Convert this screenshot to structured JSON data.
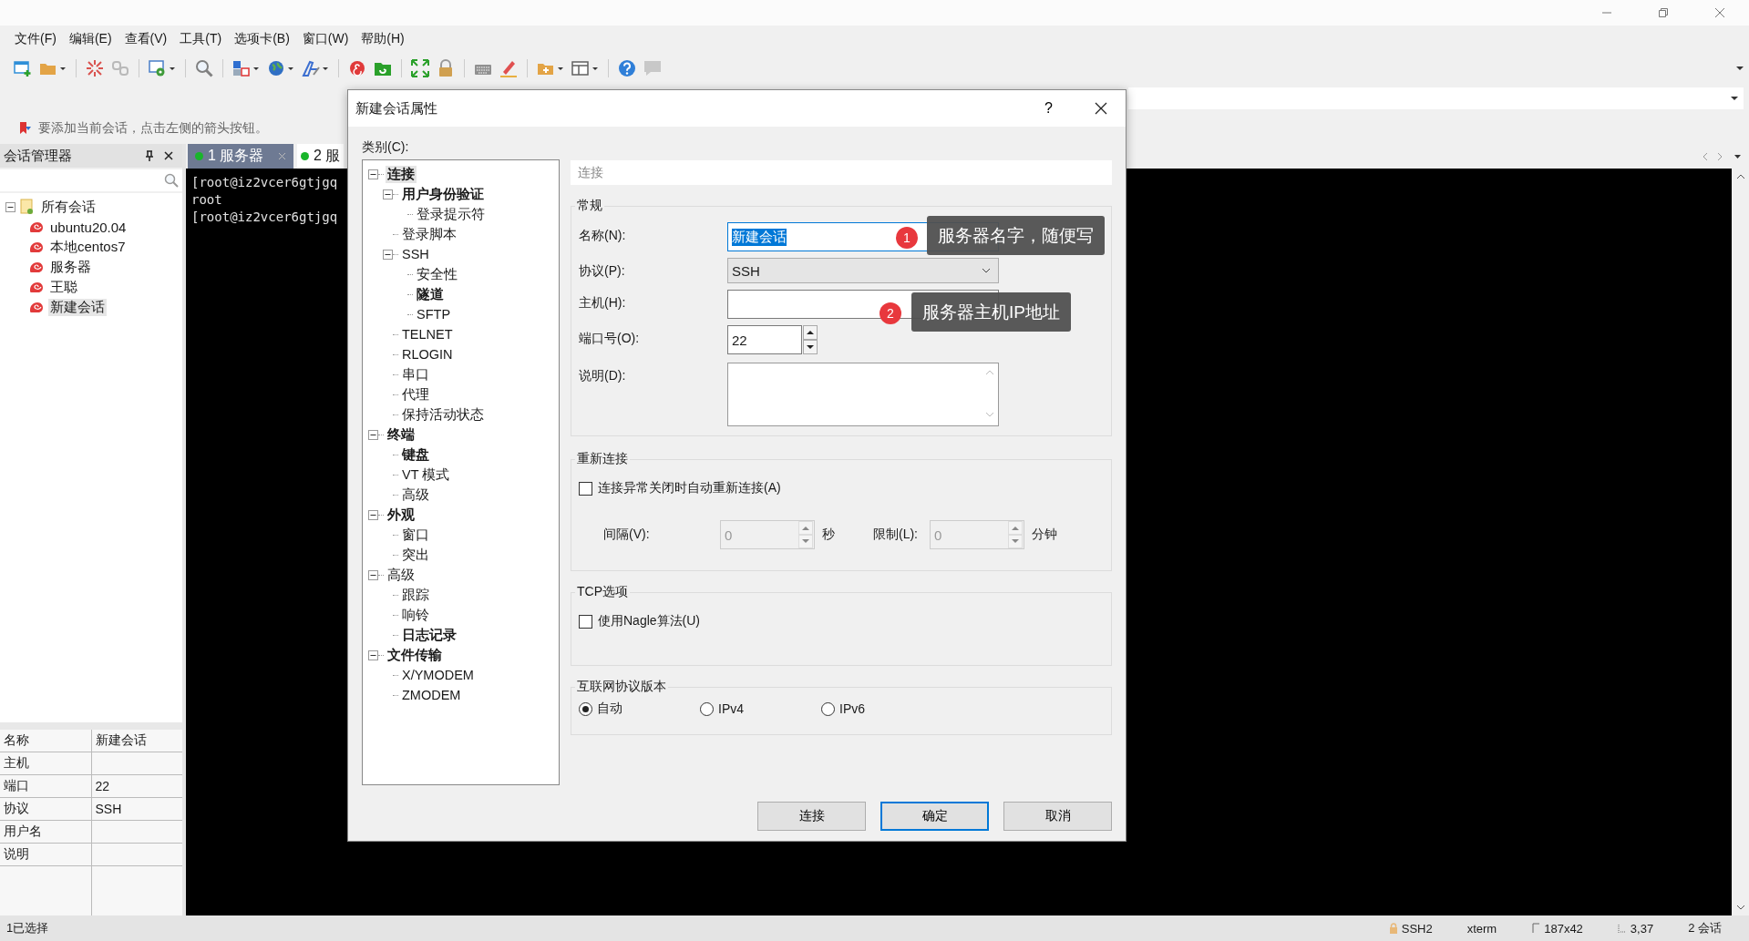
{
  "menu": [
    "文件(F)",
    "编辑(E)",
    "查看(V)",
    "工具(T)",
    "选项卡(B)",
    "窗口(W)",
    "帮助(H)"
  ],
  "hint_bar": "要添加当前会话，点击左侧的箭头按钮。",
  "session_manager": {
    "title": "会话管理器",
    "tree": [
      {
        "label": "所有会话",
        "expanded": true,
        "selected": false,
        "children": [
          {
            "label": "ubuntu20.04",
            "selected": false
          },
          {
            "label": "本地centos7",
            "selected": false
          },
          {
            "label": "服务器",
            "selected": false
          },
          {
            "label": "王聪",
            "selected": false
          },
          {
            "label": "新建会话",
            "selected": true
          }
        ]
      }
    ],
    "properties": [
      {
        "name": "名称",
        "value": "新建会话"
      },
      {
        "name": "主机"
      },
      {
        "name": "端口",
        "value": "22"
      },
      {
        "name": "协议",
        "value": "SSH"
      },
      {
        "name": "用户名"
      },
      {
        "name": "说明"
      }
    ]
  },
  "tabs": [
    {
      "label": "1 服务器",
      "selected": true,
      "closable": true
    },
    {
      "label": "2 服",
      "selected": false,
      "closable": false
    }
  ],
  "terminal_lines": [
    "[root@iz2vcer6gtjgq",
    "root",
    "[root@iz2vcer6gtjgq"
  ],
  "status_bar": {
    "left": "1已选择",
    "items": [
      {
        "kind": "lock",
        "text": "SSH2"
      },
      {
        "kind": "plain",
        "text": "xterm"
      },
      {
        "kind": "size",
        "text": "187x42"
      },
      {
        "kind": "cursor",
        "text": "3,37"
      },
      {
        "kind": "plain",
        "text": "2 会话"
      }
    ]
  },
  "dialog": {
    "title": "新建会话属性",
    "help_button": "?",
    "category_label": "类别(C):",
    "category_tree": [
      {
        "label": "连接",
        "bold": true,
        "selected": true,
        "expanded": true,
        "children": [
          {
            "label": "用户身份验证",
            "bold": true,
            "selected": false,
            "expanded": true,
            "children": [
              {
                "label": "登录提示符",
                "selected": false
              }
            ]
          },
          {
            "label": "登录脚本",
            "selected": false
          },
          {
            "label": "SSH",
            "selected": false,
            "expanded": true,
            "children": [
              {
                "label": "安全性",
                "selected": false
              },
              {
                "label": "隧道",
                "bold": true,
                "selected": false
              },
              {
                "label": "SFTP",
                "selected": false
              }
            ]
          },
          {
            "label": "TELNET",
            "selected": false
          },
          {
            "label": "RLOGIN",
            "selected": false
          },
          {
            "label": "串口",
            "selected": false
          },
          {
            "label": "代理",
            "selected": false
          },
          {
            "label": "保持活动状态",
            "selected": false
          }
        ]
      },
      {
        "label": "终端",
        "bold": true,
        "selected": false,
        "expanded": true,
        "children": [
          {
            "label": "键盘",
            "bold": true,
            "selected": false
          },
          {
            "label": "VT 模式",
            "selected": false
          },
          {
            "label": "高级",
            "selected": false
          }
        ]
      },
      {
        "label": "外观",
        "bold": true,
        "selected": false,
        "expanded": true,
        "children": [
          {
            "label": "窗口",
            "selected": false
          },
          {
            "label": "突出",
            "selected": false
          }
        ]
      },
      {
        "label": "高级",
        "selected": false,
        "expanded": true,
        "children": [
          {
            "label": "跟踪",
            "selected": false
          },
          {
            "label": "响铃",
            "selected": false
          },
          {
            "label": "日志记录",
            "bold": true,
            "selected": false
          }
        ]
      },
      {
        "label": "文件传输",
        "bold": true,
        "selected": false,
        "expanded": true,
        "children": [
          {
            "label": "X/YMODEM",
            "selected": false
          },
          {
            "label": "ZMODEM",
            "selected": false
          }
        ]
      }
    ],
    "page_title": "连接",
    "general": {
      "title": "常规",
      "name": {
        "label": "名称(N):",
        "value": "新建会话",
        "highlighted": true
      },
      "protocol": {
        "label": "协议(P):",
        "value": "SSH"
      },
      "host": {
        "label": "主机(H):"
      },
      "port": {
        "label": "端口号(O):",
        "value": "22"
      },
      "description": {
        "label": "说明(D):"
      }
    },
    "reconnect": {
      "title": "重新连接",
      "auto": {
        "label": "连接异常关闭时自动重新连接(A)",
        "checked": false
      },
      "interval": {
        "label": "间隔(V):",
        "value": "0",
        "unit": "秒",
        "disabled": true
      },
      "limit": {
        "label": "限制(L):",
        "value": "0",
        "unit": "分钟",
        "disabled": true
      }
    },
    "tcp": {
      "title": "TCP选项",
      "nagle": {
        "label": "使用Nagle算法(U)",
        "checked": false
      }
    },
    "ip_version": {
      "title": "互联网协议版本",
      "options": [
        {
          "label": "自动",
          "selected": true
        },
        {
          "label": "IPv4",
          "selected": false
        },
        {
          "label": "IPv6",
          "selected": false
        }
      ]
    },
    "buttons": [
      {
        "label": "连接",
        "default": false
      },
      {
        "label": "确定",
        "default": true
      },
      {
        "label": "取消",
        "default": false
      }
    ],
    "annotations": [
      {
        "number": "1",
        "text": "服务器名字，随便写"
      },
      {
        "number": "2",
        "text": "服务器主机IP地址"
      }
    ]
  }
}
